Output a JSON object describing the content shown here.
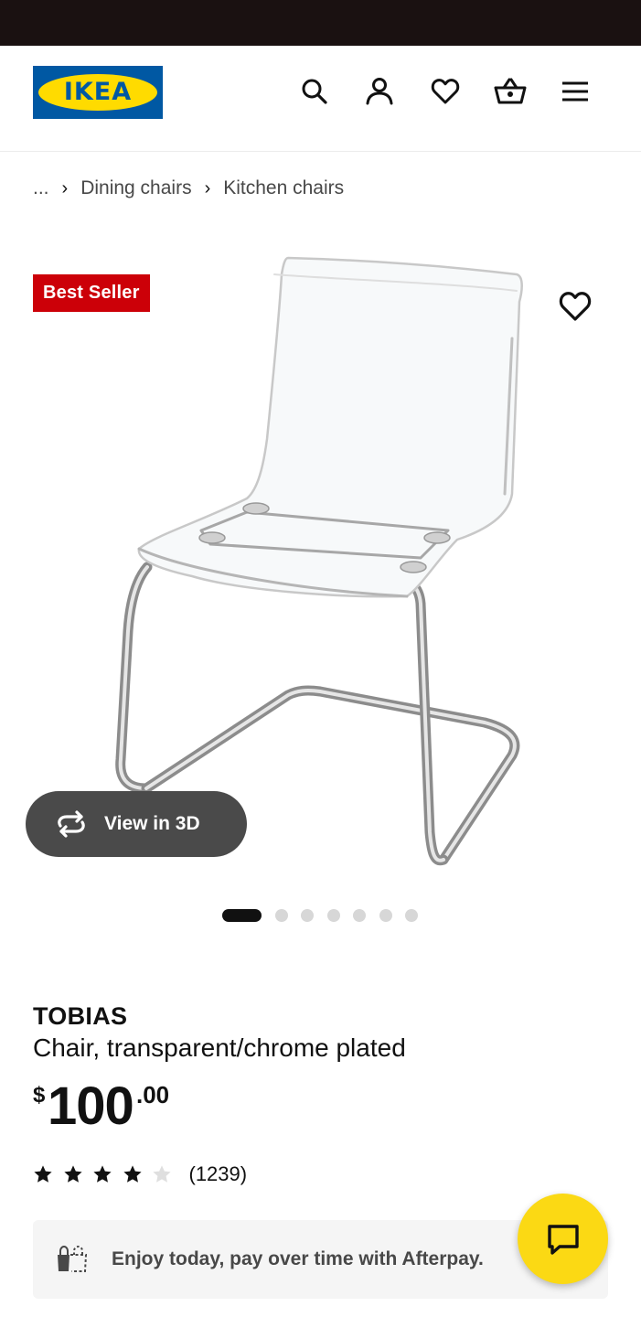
{
  "header": {
    "logo_text": "IKEA",
    "icons": [
      "search-icon",
      "user-icon",
      "heart-icon",
      "basket-icon",
      "menu-icon"
    ]
  },
  "breadcrumb": {
    "items": [
      "...",
      "Dining chairs",
      "Kitchen chairs"
    ],
    "separator": "›"
  },
  "gallery": {
    "badge": "Best Seller",
    "view_3d_label": "View in 3D",
    "image_count": 7,
    "active_index": 0
  },
  "product": {
    "name": "TOBIAS",
    "description": "Chair, transparent/chrome plated",
    "price_currency": "$",
    "price_integer": "100",
    "price_decimal": ".00",
    "rating_stars": 4,
    "rating_max": 5,
    "review_count": "(1239)"
  },
  "afterpay": {
    "text": "Enjoy today, pay over time with Afterpay."
  },
  "colors": {
    "brand_blue": "#0058a3",
    "brand_yellow": "#ffdb00",
    "badge_red": "#cc0008",
    "chat_yellow": "#fbd914"
  }
}
